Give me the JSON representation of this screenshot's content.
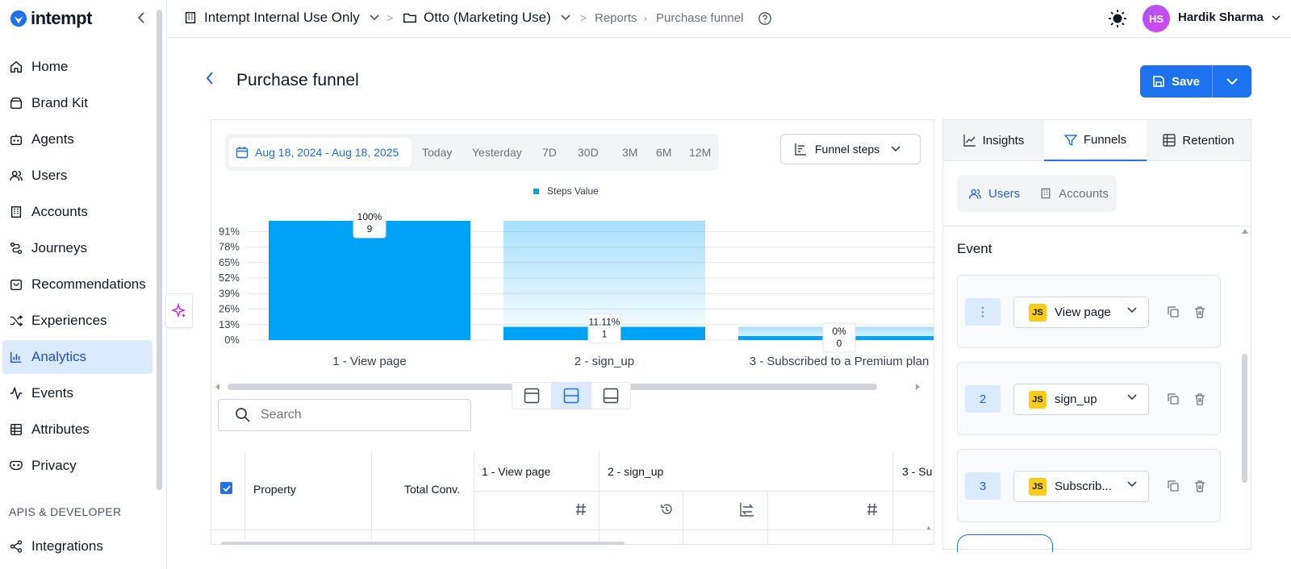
{
  "brand": {
    "name": "intempt",
    "accent": "#1d72f0"
  },
  "sidebar": {
    "items": [
      {
        "label": "Home",
        "icon": "home-icon"
      },
      {
        "label": "Brand Kit",
        "icon": "brand-kit-icon"
      },
      {
        "label": "Agents",
        "icon": "agents-icon"
      },
      {
        "label": "Users",
        "icon": "users-icon"
      },
      {
        "label": "Accounts",
        "icon": "accounts-icon"
      },
      {
        "label": "Journeys",
        "icon": "journeys-icon"
      },
      {
        "label": "Recommendations",
        "icon": "recommendations-icon"
      },
      {
        "label": "Experiences",
        "icon": "experiences-icon"
      },
      {
        "label": "Analytics",
        "icon": "analytics-icon",
        "active": true
      },
      {
        "label": "Events",
        "icon": "events-icon"
      },
      {
        "label": "Attributes",
        "icon": "attributes-icon"
      },
      {
        "label": "Privacy",
        "icon": "privacy-icon"
      }
    ],
    "section_label": "APIS & DEVELOPER",
    "integrations_label": "Integrations"
  },
  "topbar": {
    "org": "Intempt Internal Use Only",
    "project": "Otto (Marketing Use)",
    "crumb_reports": "Reports",
    "crumb_current": "Purchase funnel",
    "avatar_initials": "HS",
    "user_name": "Hardik Sharma"
  },
  "page": {
    "title": "Purchase funnel",
    "save_label": "Save"
  },
  "filters": {
    "date_range": "Aug 18, 2024 - Aug 18, 2025",
    "options": [
      "Today",
      "Yesterday",
      "7D",
      "30D",
      "3M",
      "6M",
      "12M"
    ],
    "funnel_steps_label": "Funnel steps"
  },
  "chart_data": {
    "type": "bar",
    "categories": [
      "1 - View page",
      "2 - sign_up",
      "3 - Subscribed to a Premium plan"
    ],
    "series": [
      {
        "name": "Steps Value",
        "values": [
          9,
          1,
          0
        ]
      }
    ],
    "percentages": [
      "100%",
      "11.11%",
      "0%"
    ],
    "y_ticks": [
      "91%",
      "78%",
      "65%",
      "52%",
      "39%",
      "26%",
      "13%",
      "0%"
    ],
    "ylim": [
      0,
      100
    ],
    "legend_position": "top-center",
    "bar_color": "#00a3f5"
  },
  "table": {
    "search_placeholder": "Search",
    "headers": {
      "property": "Property",
      "total": "Total Conv.",
      "step1": "1 - View page",
      "step2": "2 - sign_up",
      "step3": "3 - Su"
    }
  },
  "right_panel": {
    "tabs": [
      {
        "label": "Insights",
        "icon": "insights-icon"
      },
      {
        "label": "Funnels",
        "icon": "funnel-icon",
        "active": true
      },
      {
        "label": "Retention",
        "icon": "retention-icon"
      }
    ],
    "segment": {
      "users": "Users",
      "accounts": "Accounts"
    },
    "event_label": "Event",
    "steps": [
      {
        "number": "⋮",
        "badge": "JS",
        "name": "View page"
      },
      {
        "number": "2",
        "badge": "JS",
        "name": "sign_up"
      },
      {
        "number": "3",
        "badge": "JS",
        "name": "Subscrib..."
      }
    ]
  }
}
